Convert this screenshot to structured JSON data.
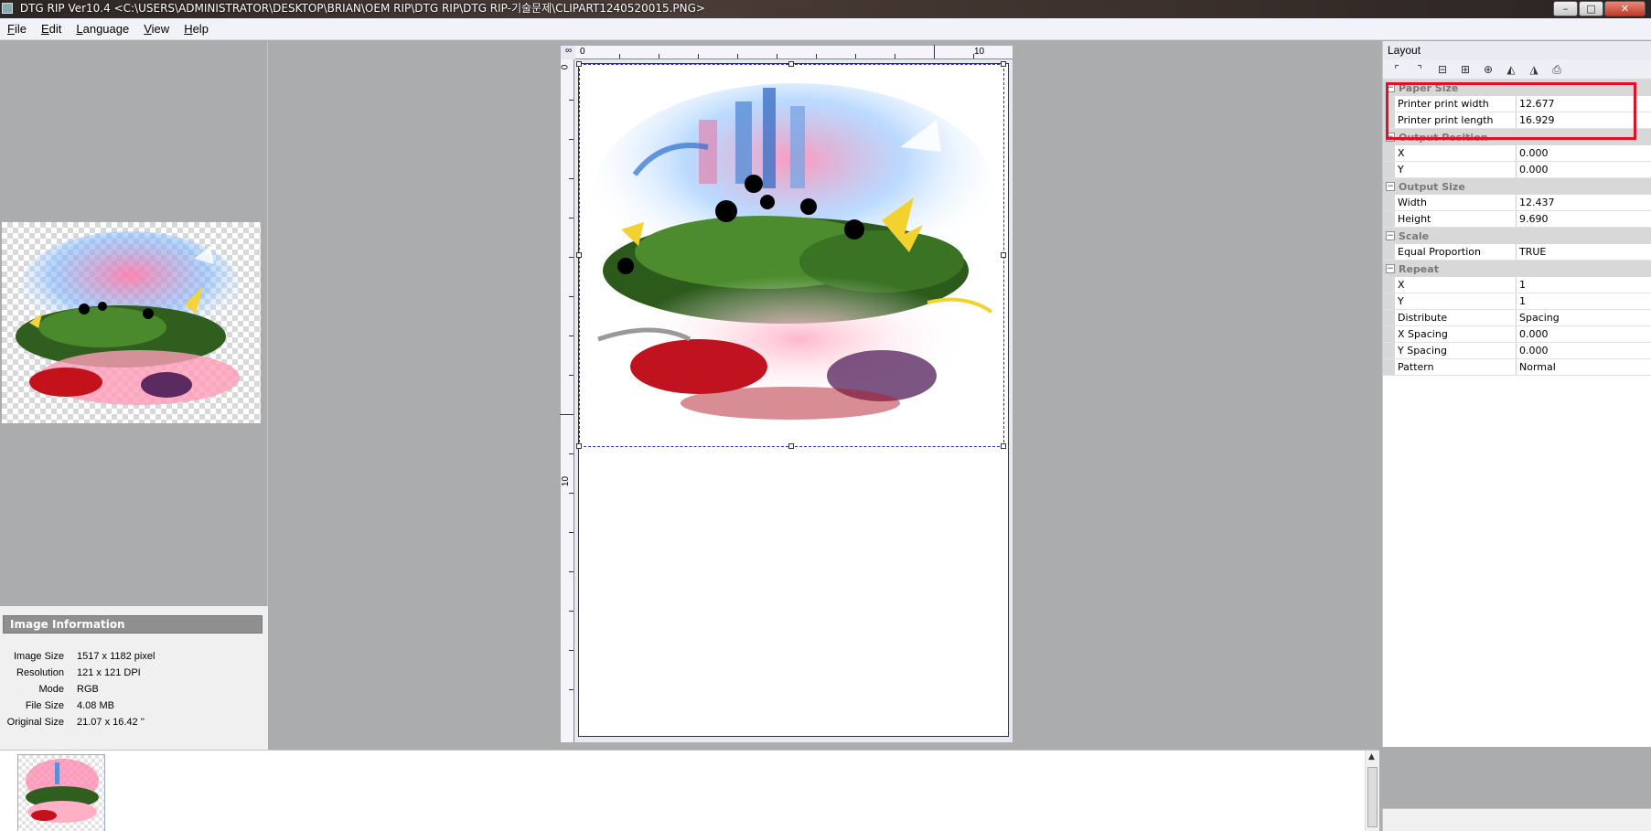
{
  "window": {
    "title": "DTG RIP Ver10.4 <C:\\USERS\\ADMINISTRATOR\\DESKTOP\\BRIAN\\OEM RIP\\DTG RIP\\DTG RIP-기술문제\\CLIPART1240520015.PNG>",
    "minimize": "–",
    "maximize": "□",
    "close": "✕"
  },
  "menu": {
    "file_key": "F",
    "file_rest": "ile",
    "edit_key": "E",
    "edit_rest": "dit",
    "language_key": "L",
    "language_rest": "anguage",
    "view_key": "V",
    "view_rest": "iew",
    "help_key": "H",
    "help_rest": "elp"
  },
  "image_info": {
    "header": "Image Information",
    "rows": [
      {
        "label": "Image Size",
        "value": "1517 x 1182 pixel"
      },
      {
        "label": "Resolution",
        "value": "121 x 121 DPI"
      },
      {
        "label": "Mode",
        "value": "RGB"
      },
      {
        "label": "File Size",
        "value": "4.08 MB"
      },
      {
        "label": "Original Size",
        "value": "21.07 x 16.42 ''"
      }
    ]
  },
  "rulers": {
    "top_zero": "0",
    "top_ten": "10",
    "left_zero": "0",
    "left_ten": "10",
    "corner": "∞"
  },
  "layout": {
    "title": "Layout",
    "categories": [
      {
        "name": "Paper Size",
        "props": [
          {
            "label": "Printer print width",
            "value": "12.677"
          },
          {
            "label": "Printer print length",
            "value": "16.929"
          }
        ]
      },
      {
        "name": "Output Position",
        "props": [
          {
            "label": "X",
            "value": "0.000"
          },
          {
            "label": "Y",
            "value": "0.000"
          }
        ]
      },
      {
        "name": "Output Size",
        "props": [
          {
            "label": "Width",
            "value": "12.437"
          },
          {
            "label": "Height",
            "value": "9.690"
          }
        ]
      },
      {
        "name": "Scale",
        "props": [
          {
            "label": "Equal Proportion",
            "value": "TRUE"
          }
        ]
      },
      {
        "name": "Repeat",
        "props": [
          {
            "label": "X",
            "value": "1"
          },
          {
            "label": "Y",
            "value": "1"
          },
          {
            "label": "Distribute",
            "value": "Spacing"
          },
          {
            "label": "X Spacing",
            "value": "0.000"
          },
          {
            "label": "Y Spacing",
            "value": "0.000"
          },
          {
            "label": "Pattern",
            "value": "Normal"
          }
        ]
      }
    ]
  },
  "colors": {
    "highlight": "#e0102a",
    "selection_dash": "#1e2fbf"
  },
  "icons": {
    "toolbar": [
      "align-top-left-icon",
      "align-top-right-icon",
      "center-horizontal-icon",
      "center-vertical-icon",
      "center-both-icon",
      "flip-horizontal-icon",
      "mirror-icon",
      "print-icon"
    ]
  }
}
